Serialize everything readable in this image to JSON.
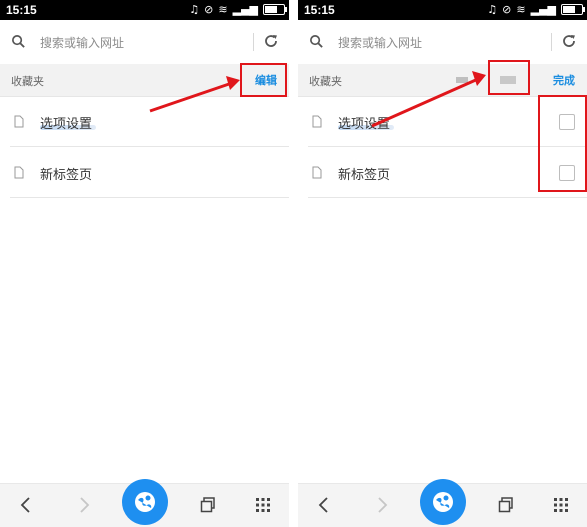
{
  "screens": [
    {
      "status": {
        "time": "15:15"
      },
      "search": {
        "placeholder": "搜索或输入网址"
      },
      "header": {
        "title": "收藏夹",
        "action": "编辑"
      },
      "items": [
        {
          "label": "选项设置"
        },
        {
          "label": "新标签页"
        }
      ]
    },
    {
      "status": {
        "time": "15:15"
      },
      "search": {
        "placeholder": "搜索或输入网址"
      },
      "header": {
        "title": "收藏夹",
        "action": "完成"
      },
      "items": [
        {
          "label": "选项设置"
        },
        {
          "label": "新标签页"
        }
      ]
    }
  ],
  "colors": {
    "accent": "#1a8de0",
    "annotation": "#e0161b",
    "home_button": "#1e8ff0"
  },
  "icons": [
    "search-icon",
    "refresh-icon",
    "document-icon",
    "back-icon",
    "forward-icon",
    "browser-home-icon",
    "tabs-icon",
    "menu-grid-icon",
    "wifi-icon",
    "signal-icon",
    "battery-icon",
    "headphones-icon",
    "alarm-icon"
  ]
}
